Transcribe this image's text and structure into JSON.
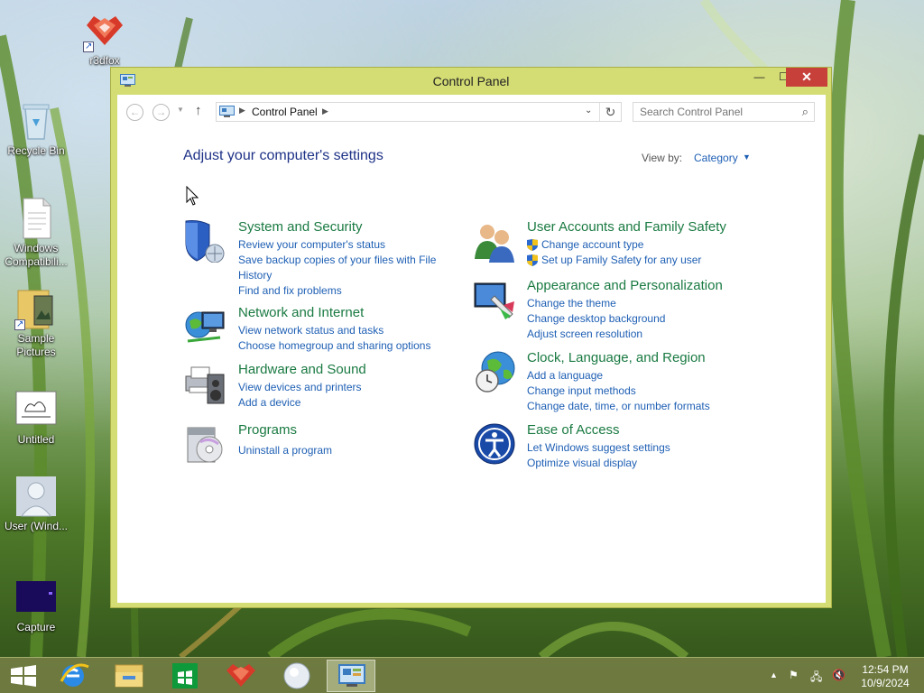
{
  "desktop": {
    "icons": [
      {
        "label": "r3dfox"
      },
      {
        "label": "Recycle Bin"
      },
      {
        "label": "Windows Compatibili..."
      },
      {
        "label": "Sample Pictures"
      },
      {
        "label": "Untitled"
      },
      {
        "label": "User (Wind..."
      },
      {
        "label": "Capture"
      }
    ]
  },
  "window": {
    "title": "Control Panel",
    "controls": {
      "minimize": "—",
      "maximize": "☐",
      "close": "✕"
    },
    "address": {
      "location": "Control Panel"
    },
    "search": {
      "placeholder": "Search Control Panel"
    },
    "heading": "Adjust your computer's settings",
    "view_by": {
      "label": "View by:",
      "value": "Category"
    },
    "categories": [
      {
        "title": "System and Security",
        "icon": "shield-icon",
        "links": [
          "Review your computer's status",
          "Save backup copies of your files with File History",
          "Find and fix problems"
        ]
      },
      {
        "title": "Network and Internet",
        "icon": "network-globe-icon",
        "links": [
          "View network status and tasks",
          "Choose homegroup and sharing options"
        ]
      },
      {
        "title": "Hardware and Sound",
        "icon": "printer-speaker-icon",
        "links": [
          "View devices and printers",
          "Add a device"
        ]
      },
      {
        "title": "Programs",
        "icon": "programs-disc-icon",
        "links": [
          "Uninstall a program"
        ]
      },
      {
        "title": "User Accounts and Family Safety",
        "icon": "users-icon",
        "links": [
          "Change account type",
          "Set up Family Safety for any user"
        ]
      },
      {
        "title": "Appearance and Personalization",
        "icon": "monitor-paint-icon",
        "links": [
          "Change the theme",
          "Change desktop background",
          "Adjust screen resolution"
        ]
      },
      {
        "title": "Clock, Language, and Region",
        "icon": "clock-globe-icon",
        "links": [
          "Add a language",
          "Change input methods",
          "Change date, time, or number formats"
        ]
      },
      {
        "title": "Ease of Access",
        "icon": "ease-of-access-icon",
        "links": [
          "Let Windows suggest settings",
          "Optimize visual display"
        ]
      }
    ]
  },
  "taskbar": {
    "items": [
      "start-icon",
      "internet-explorer-icon",
      "file-explorer-icon",
      "windows-store-icon",
      "r3dfox-icon",
      "user-icon",
      "control-panel-icon"
    ],
    "clock": {
      "time": "12:54 PM",
      "date": "10/9/2024"
    }
  },
  "colors": {
    "window_frame": "#d4dc74",
    "close_button": "#c7403a",
    "link": "#1e5fb4",
    "category_title": "#1a7a42",
    "heading": "#1e3287"
  }
}
